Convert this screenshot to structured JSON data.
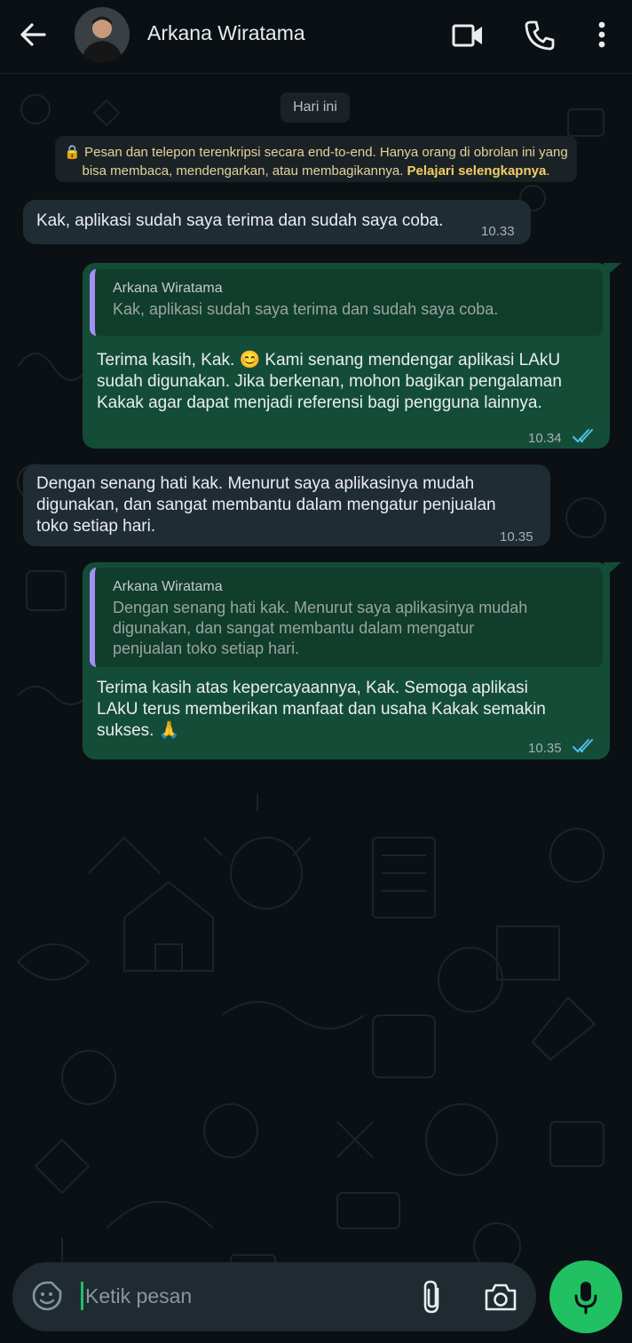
{
  "header": {
    "contact_name": "Arkana Wiratama",
    "icons": [
      "back-arrow-icon",
      "video-call-icon",
      "voice-call-icon",
      "more-vertical-icon"
    ]
  },
  "chat": {
    "date_chip": "Hari ini",
    "encryption_notice": {
      "line1": "Pesan dan telepon terenkripsi secara end-to-end. Hanya orang di obrolan ini yang",
      "line2": "bisa membaca, mendengarkan, atau membagikannya.",
      "link": "Pelajari selengkapnya",
      "suffix": "."
    },
    "messages": [
      {
        "direction": "incoming",
        "text": "Kak, aplikasi sudah saya terima dan sudah saya coba.",
        "time": "10.33"
      },
      {
        "direction": "outgoing",
        "quote_name": "Arkana Wiratama",
        "quote_text": "Kak, aplikasi sudah saya terima dan sudah saya coba.",
        "lines": [
          "Terima kasih, Kak. 😊 Kami senang mendengar aplikasi LAkU",
          "sudah digunakan. Jika berkenan, mohon bagikan pengalaman",
          "Kakak agar dapat menjadi referensi bagi pengguna lainnya."
        ],
        "time": "10.34",
        "status": "read"
      },
      {
        "direction": "incoming",
        "lines": [
          "Dengan senang hati kak. Menurut saya aplikasinya mudah",
          "digunakan, dan sangat membantu dalam mengatur penjualan",
          "toko setiap hari."
        ],
        "time": "10.35"
      },
      {
        "direction": "outgoing",
        "quote_name": "Arkana Wiratama",
        "quote_lines": [
          "Dengan senang hati kak. Menurut saya aplikasinya mudah",
          "digunakan, dan sangat membantu dalam mengatur",
          "penjualan toko setiap hari."
        ],
        "lines": [
          "Terima kasih atas kepercayaannya, Kak. Semoga aplikasi",
          "LAkU terus memberikan manfaat dan usaha Kakak semakin",
          "sukses. 🙏"
        ],
        "time": "10.35",
        "status": "read"
      }
    ]
  },
  "composer": {
    "placeholder": "Ketik pesan",
    "icons": [
      "sticker-icon",
      "attach-icon",
      "camera-icon",
      "mic-icon"
    ]
  },
  "colors": {
    "background": "#0b1014",
    "incoming_bubble": "#202c33",
    "outgoing_bubble": "#144d37",
    "accent_green": "#21c063",
    "read_ticks": "#53bdeb",
    "quote_bar": "#a58ff4"
  }
}
